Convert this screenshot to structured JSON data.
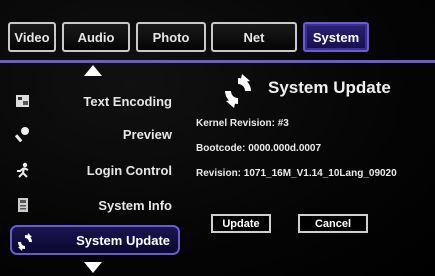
{
  "tabs": [
    {
      "label": "Video"
    },
    {
      "label": "Audio"
    },
    {
      "label": "Photo"
    },
    {
      "label": "Net"
    },
    {
      "label": "System"
    }
  ],
  "menu": {
    "items": [
      {
        "label": "Text Encoding",
        "icon": "text-encoding-icon"
      },
      {
        "label": "Preview",
        "icon": "preview-icon"
      },
      {
        "label": "Login Control",
        "icon": "login-control-icon"
      },
      {
        "label": "System Info",
        "icon": "system-info-icon"
      },
      {
        "label": "System Update",
        "icon": "refresh-icon"
      }
    ],
    "selected_index": 4
  },
  "panel": {
    "title": "System Update",
    "kernel_revision": "Kernel Revision: #3",
    "bootcode": "Bootcode: 0000.000d.0007",
    "revision": "Revision: 1071_16M_V1.14_10Lang_09020"
  },
  "buttons": {
    "update": "Update",
    "cancel": "Cancel"
  },
  "colors": {
    "accent": "#6a5cc9",
    "background": "#000000",
    "text": "#ffffff"
  }
}
